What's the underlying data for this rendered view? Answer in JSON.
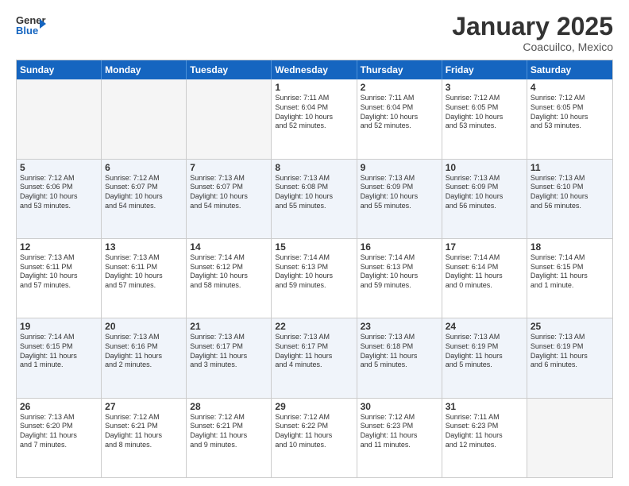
{
  "header": {
    "logo_general": "General",
    "logo_blue": "Blue",
    "month_year": "January 2025",
    "location": "Coacuilco, Mexico"
  },
  "weekdays": [
    "Sunday",
    "Monday",
    "Tuesday",
    "Wednesday",
    "Thursday",
    "Friday",
    "Saturday"
  ],
  "weeks": [
    [
      {
        "day": "",
        "lines": []
      },
      {
        "day": "",
        "lines": []
      },
      {
        "day": "",
        "lines": []
      },
      {
        "day": "1",
        "lines": [
          "Sunrise: 7:11 AM",
          "Sunset: 6:04 PM",
          "Daylight: 10 hours",
          "and 52 minutes."
        ]
      },
      {
        "day": "2",
        "lines": [
          "Sunrise: 7:11 AM",
          "Sunset: 6:04 PM",
          "Daylight: 10 hours",
          "and 52 minutes."
        ]
      },
      {
        "day": "3",
        "lines": [
          "Sunrise: 7:12 AM",
          "Sunset: 6:05 PM",
          "Daylight: 10 hours",
          "and 53 minutes."
        ]
      },
      {
        "day": "4",
        "lines": [
          "Sunrise: 7:12 AM",
          "Sunset: 6:05 PM",
          "Daylight: 10 hours",
          "and 53 minutes."
        ]
      }
    ],
    [
      {
        "day": "5",
        "lines": [
          "Sunrise: 7:12 AM",
          "Sunset: 6:06 PM",
          "Daylight: 10 hours",
          "and 53 minutes."
        ]
      },
      {
        "day": "6",
        "lines": [
          "Sunrise: 7:12 AM",
          "Sunset: 6:07 PM",
          "Daylight: 10 hours",
          "and 54 minutes."
        ]
      },
      {
        "day": "7",
        "lines": [
          "Sunrise: 7:13 AM",
          "Sunset: 6:07 PM",
          "Daylight: 10 hours",
          "and 54 minutes."
        ]
      },
      {
        "day": "8",
        "lines": [
          "Sunrise: 7:13 AM",
          "Sunset: 6:08 PM",
          "Daylight: 10 hours",
          "and 55 minutes."
        ]
      },
      {
        "day": "9",
        "lines": [
          "Sunrise: 7:13 AM",
          "Sunset: 6:09 PM",
          "Daylight: 10 hours",
          "and 55 minutes."
        ]
      },
      {
        "day": "10",
        "lines": [
          "Sunrise: 7:13 AM",
          "Sunset: 6:09 PM",
          "Daylight: 10 hours",
          "and 56 minutes."
        ]
      },
      {
        "day": "11",
        "lines": [
          "Sunrise: 7:13 AM",
          "Sunset: 6:10 PM",
          "Daylight: 10 hours",
          "and 56 minutes."
        ]
      }
    ],
    [
      {
        "day": "12",
        "lines": [
          "Sunrise: 7:13 AM",
          "Sunset: 6:11 PM",
          "Daylight: 10 hours",
          "and 57 minutes."
        ]
      },
      {
        "day": "13",
        "lines": [
          "Sunrise: 7:13 AM",
          "Sunset: 6:11 PM",
          "Daylight: 10 hours",
          "and 57 minutes."
        ]
      },
      {
        "day": "14",
        "lines": [
          "Sunrise: 7:14 AM",
          "Sunset: 6:12 PM",
          "Daylight: 10 hours",
          "and 58 minutes."
        ]
      },
      {
        "day": "15",
        "lines": [
          "Sunrise: 7:14 AM",
          "Sunset: 6:13 PM",
          "Daylight: 10 hours",
          "and 59 minutes."
        ]
      },
      {
        "day": "16",
        "lines": [
          "Sunrise: 7:14 AM",
          "Sunset: 6:13 PM",
          "Daylight: 10 hours",
          "and 59 minutes."
        ]
      },
      {
        "day": "17",
        "lines": [
          "Sunrise: 7:14 AM",
          "Sunset: 6:14 PM",
          "Daylight: 11 hours",
          "and 0 minutes."
        ]
      },
      {
        "day": "18",
        "lines": [
          "Sunrise: 7:14 AM",
          "Sunset: 6:15 PM",
          "Daylight: 11 hours",
          "and 1 minute."
        ]
      }
    ],
    [
      {
        "day": "19",
        "lines": [
          "Sunrise: 7:14 AM",
          "Sunset: 6:15 PM",
          "Daylight: 11 hours",
          "and 1 minute."
        ]
      },
      {
        "day": "20",
        "lines": [
          "Sunrise: 7:13 AM",
          "Sunset: 6:16 PM",
          "Daylight: 11 hours",
          "and 2 minutes."
        ]
      },
      {
        "day": "21",
        "lines": [
          "Sunrise: 7:13 AM",
          "Sunset: 6:17 PM",
          "Daylight: 11 hours",
          "and 3 minutes."
        ]
      },
      {
        "day": "22",
        "lines": [
          "Sunrise: 7:13 AM",
          "Sunset: 6:17 PM",
          "Daylight: 11 hours",
          "and 4 minutes."
        ]
      },
      {
        "day": "23",
        "lines": [
          "Sunrise: 7:13 AM",
          "Sunset: 6:18 PM",
          "Daylight: 11 hours",
          "and 5 minutes."
        ]
      },
      {
        "day": "24",
        "lines": [
          "Sunrise: 7:13 AM",
          "Sunset: 6:19 PM",
          "Daylight: 11 hours",
          "and 5 minutes."
        ]
      },
      {
        "day": "25",
        "lines": [
          "Sunrise: 7:13 AM",
          "Sunset: 6:19 PM",
          "Daylight: 11 hours",
          "and 6 minutes."
        ]
      }
    ],
    [
      {
        "day": "26",
        "lines": [
          "Sunrise: 7:13 AM",
          "Sunset: 6:20 PM",
          "Daylight: 11 hours",
          "and 7 minutes."
        ]
      },
      {
        "day": "27",
        "lines": [
          "Sunrise: 7:12 AM",
          "Sunset: 6:21 PM",
          "Daylight: 11 hours",
          "and 8 minutes."
        ]
      },
      {
        "day": "28",
        "lines": [
          "Sunrise: 7:12 AM",
          "Sunset: 6:21 PM",
          "Daylight: 11 hours",
          "and 9 minutes."
        ]
      },
      {
        "day": "29",
        "lines": [
          "Sunrise: 7:12 AM",
          "Sunset: 6:22 PM",
          "Daylight: 11 hours",
          "and 10 minutes."
        ]
      },
      {
        "day": "30",
        "lines": [
          "Sunrise: 7:12 AM",
          "Sunset: 6:23 PM",
          "Daylight: 11 hours",
          "and 11 minutes."
        ]
      },
      {
        "day": "31",
        "lines": [
          "Sunrise: 7:11 AM",
          "Sunset: 6:23 PM",
          "Daylight: 11 hours",
          "and 12 minutes."
        ]
      },
      {
        "day": "",
        "lines": []
      }
    ]
  ]
}
